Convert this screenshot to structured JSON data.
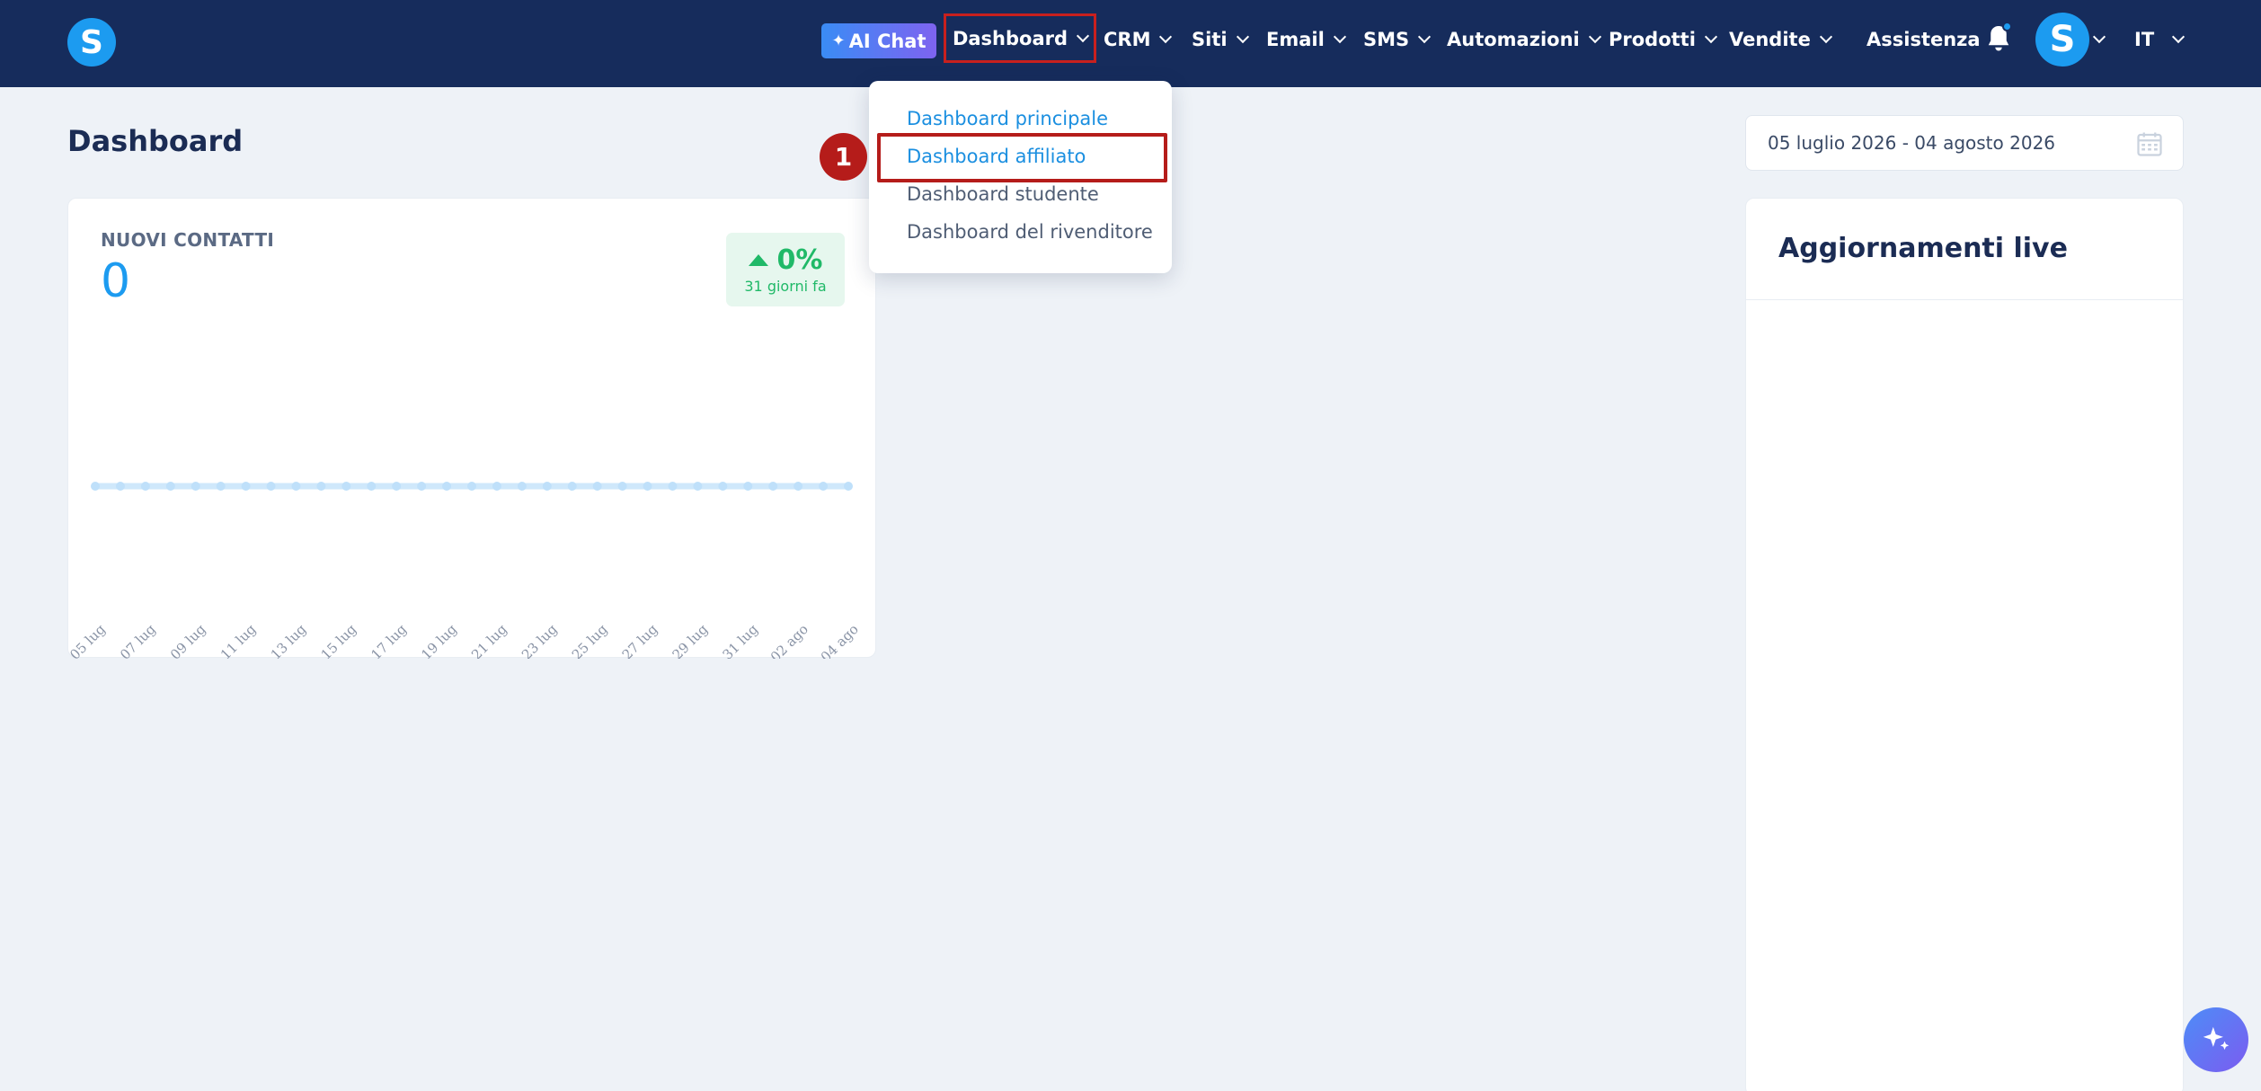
{
  "app": {
    "logo_letter": "S",
    "brand_color": "#1c9bf0",
    "nav_bg": "#162c5c"
  },
  "topbar": {
    "ai_chat_label": "AI Chat",
    "nav": [
      {
        "label": "Dashboard",
        "has_dropdown": true,
        "open": true
      },
      {
        "label": "CRM",
        "has_dropdown": true
      },
      {
        "label": "Siti",
        "has_dropdown": true
      },
      {
        "label": "Email",
        "has_dropdown": true
      },
      {
        "label": "SMS",
        "has_dropdown": true
      },
      {
        "label": "Automazioni",
        "has_dropdown": true
      },
      {
        "label": "Prodotti",
        "has_dropdown": true
      },
      {
        "label": "Vendite",
        "has_dropdown": true
      }
    ],
    "help_label": "Assistenza",
    "avatar_letter": "S",
    "language": "IT"
  },
  "dropdown": {
    "items": [
      {
        "label": "Dashboard principale",
        "active": true
      },
      {
        "label": "Dashboard affiliato",
        "active": true,
        "highlighted": true
      },
      {
        "label": "Dashboard studente",
        "active": false
      },
      {
        "label": "Dashboard del rivenditore",
        "active": false
      }
    ],
    "step_number": "1"
  },
  "page": {
    "title": "Dashboard",
    "date_range": "05 luglio 2026 - 04 agosto 2026"
  },
  "card": {
    "label": "NUOVI CONTATTI",
    "value": "0",
    "delta": "0%",
    "delta_sub": "31 giorni fa"
  },
  "chart_data": {
    "type": "line",
    "x": [
      "05 lug",
      "06 lug",
      "07 lug",
      "08 lug",
      "09 lug",
      "10 lug",
      "11 lug",
      "12 lug",
      "13 lug",
      "14 lug",
      "15 lug",
      "16 lug",
      "17 lug",
      "18 lug",
      "19 lug",
      "20 lug",
      "21 lug",
      "22 lug",
      "23 lug",
      "24 lug",
      "25 lug",
      "26 lug",
      "27 lug",
      "28 lug",
      "29 lug",
      "30 lug",
      "31 lug",
      "01 ago",
      "02 ago",
      "03 ago",
      "04 ago"
    ],
    "tick_labels": [
      "05 lug",
      "07 lug",
      "09 lug",
      "11 lug",
      "13 lug",
      "15 lug",
      "17 lug",
      "19 lug",
      "21 lug",
      "23 lug",
      "25 lug",
      "27 lug",
      "29 lug",
      "31 lug",
      "02 ago",
      "04 ago"
    ],
    "series": [
      {
        "values": [
          0,
          0,
          0,
          0,
          0,
          0,
          0,
          0,
          0,
          0,
          0,
          0,
          0,
          0,
          0,
          0,
          0,
          0,
          0,
          0,
          0,
          0,
          0,
          0,
          0,
          0,
          0,
          0,
          0,
          0,
          0
        ],
        "color": "#cfe8fb"
      }
    ]
  },
  "live": {
    "title": "Aggiornamenti live"
  }
}
